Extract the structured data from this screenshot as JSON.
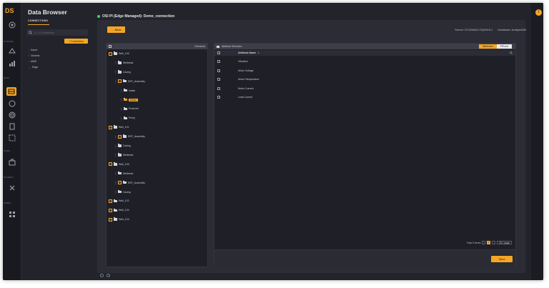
{
  "rail": {
    "logo": "DS",
    "sections": [
      "SYSTEM",
      "DATA",
      "USER",
      "OTHERS",
      "ADMIN"
    ]
  },
  "browser": {
    "title": "Data Browser",
    "tab": "CONNECTIONS",
    "search_placeholder": "Q  (+) Connection",
    "add_connection": "+ Connection",
    "tree": [
      "Azure",
      "Generic",
      "AWS",
      "Edge"
    ]
  },
  "header": {
    "connection_title": "OSI PI (Edge Managed): Demo_connection",
    "server_label": "Server: EC2AMAZ-OQNVHLJ",
    "database_label": "Database: AnalysisDB"
  },
  "toolbar": {
    "back_label": "← Back"
  },
  "elements_panel": {
    "header": "Elements",
    "rows": [
      {
        "label": "Well_105",
        "depth": 0,
        "type": "parent"
      },
      {
        "label": "Wellhead",
        "depth": 1,
        "type": "leaf"
      },
      {
        "label": "Casing",
        "depth": 1,
        "type": "leaf"
      },
      {
        "label": "ESP_Assembly",
        "depth": 1,
        "type": "parent"
      },
      {
        "label": "Intake",
        "depth": 2,
        "type": "leaf"
      },
      {
        "label": "Motor",
        "depth": 2,
        "type": "leaf",
        "selected": true
      },
      {
        "label": "Protector",
        "depth": 2,
        "type": "leaf"
      },
      {
        "label": "Pump",
        "depth": 2,
        "type": "leaf"
      },
      {
        "label": "Well_101",
        "depth": 0,
        "type": "parent"
      },
      {
        "label": "ESP_Assembly",
        "depth": 1,
        "type": "parent"
      },
      {
        "label": "Casing",
        "depth": 1,
        "type": "leaf"
      },
      {
        "label": "Wellhead",
        "depth": 1,
        "type": "leaf"
      },
      {
        "label": "Well_106",
        "depth": 0,
        "type": "parent"
      },
      {
        "label": "Wellhead",
        "depth": 1,
        "type": "leaf"
      },
      {
        "label": "ESP_Assembly",
        "depth": 1,
        "type": "parent"
      },
      {
        "label": "Casing",
        "depth": 1,
        "type": "leaf"
      },
      {
        "label": "Well_102",
        "depth": 0,
        "type": "parent"
      },
      {
        "label": "Well_104",
        "depth": 0,
        "type": "parent"
      },
      {
        "label": "Well_103",
        "depth": 0,
        "type": "parent"
      }
    ]
  },
  "attributes_panel": {
    "header": "Attribute Selection",
    "toggle": {
      "attributes": "Attributes",
      "pipoint": "PIPoint"
    },
    "column": "Attribute Name",
    "rows": [
      "Vibration",
      "Motor Voltage",
      "Motor Temperature",
      "Motor Current",
      "Leak Current"
    ],
    "total_text": "Total 5 items",
    "current_page": "1",
    "page_size": "20 / page",
    "next_label": "Next"
  },
  "colors": {
    "accent": "#f5a623",
    "status": "#3ad17a",
    "background": "#1e1f26"
  },
  "icons": [
    "search-icon",
    "folder-icon",
    "chevron-icon",
    "filter-icon",
    "grid-icon",
    "gear-icon"
  ]
}
